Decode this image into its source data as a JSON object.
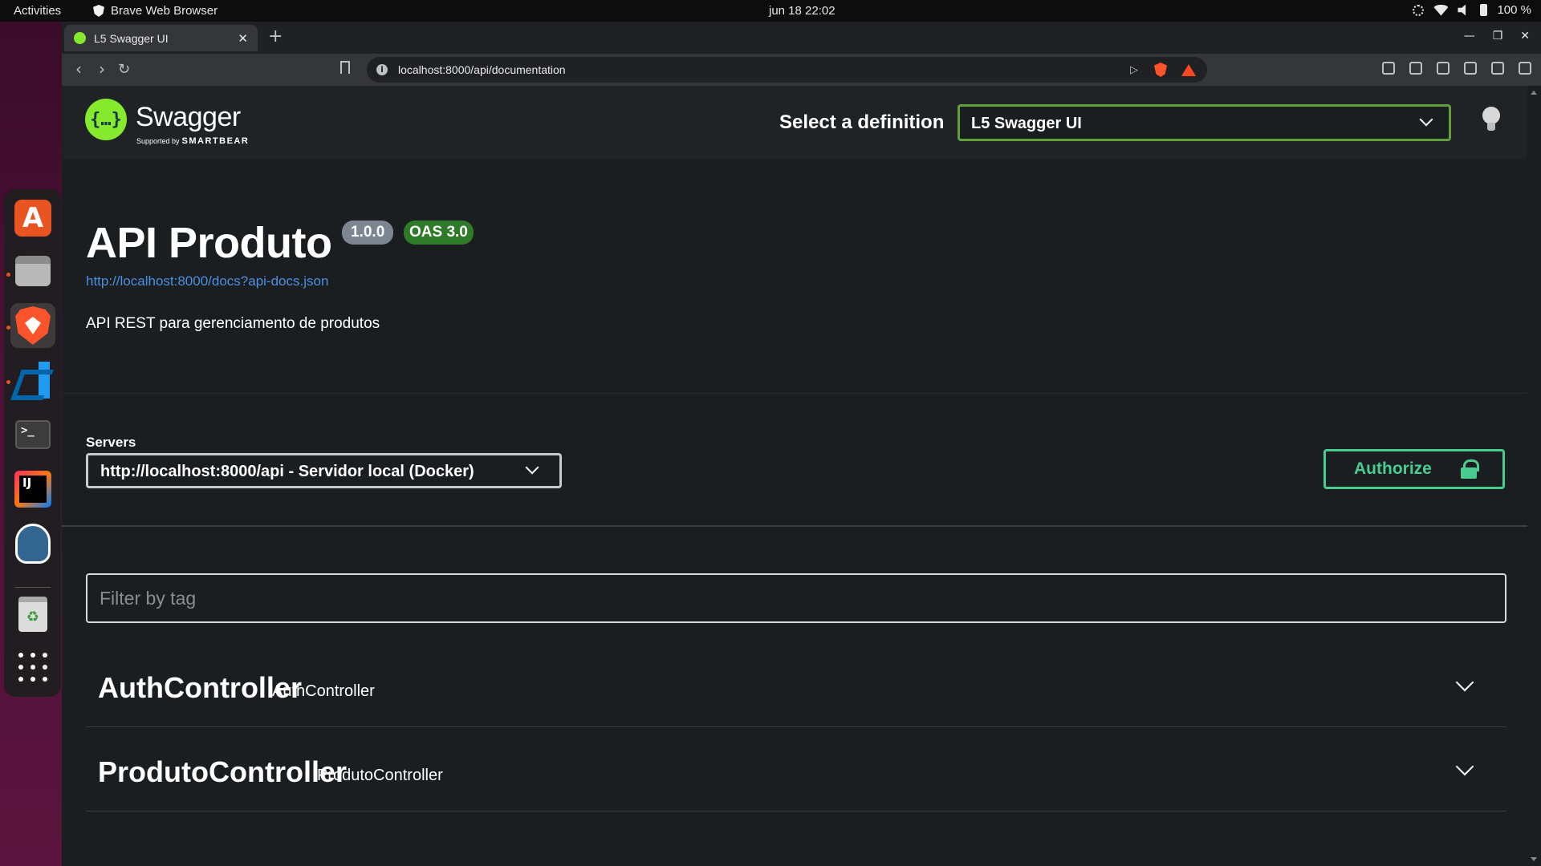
{
  "system": {
    "activities": "Activities",
    "app_name": "Brave Web Browser",
    "clock": "jun 18  22:02",
    "battery": "100 %"
  },
  "browser": {
    "tab_title": "L5 Swagger UI",
    "url": "localhost:8000/api/documentation"
  },
  "swagger": {
    "brand": "Swagger",
    "supported_by": "Supported by",
    "smartbear": "SMARTBEAR",
    "select_definition_label": "Select a definition",
    "definition_selected": "L5 Swagger UI",
    "title": "API Produto",
    "version": "1.0.0",
    "oas": "OAS 3.0",
    "spec_link": "http://localhost:8000/docs?api-docs.json",
    "description": "API REST para gerenciamento de produtos",
    "servers_label": "Servers",
    "server_selected": "http://localhost:8000/api - Servidor local (Docker)",
    "authorize_label": "Authorize",
    "filter_placeholder": "Filter by tag",
    "tags": [
      {
        "name": "AuthController",
        "description": "AuthController"
      },
      {
        "name": "ProdutoController",
        "description": "ProdutoController"
      }
    ]
  },
  "colors": {
    "swagger_green": "#85ea2d",
    "definition_border": "#62a03f",
    "authorize": "#49cc90",
    "link": "#4990e2",
    "page_bg": "#1b1e21"
  }
}
